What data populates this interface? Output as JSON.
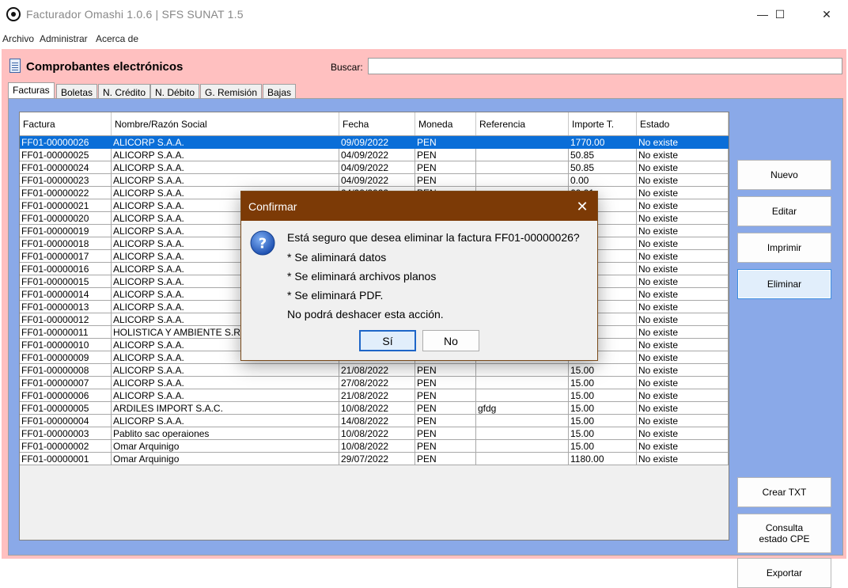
{
  "window": {
    "title": "Facturador Omashi 1.0.6 | SFS SUNAT 1.5",
    "minimize": "—",
    "maximize": "☐",
    "close": "✕"
  },
  "menu": [
    "Archivo",
    "Administrar",
    "Acerca de"
  ],
  "header": {
    "title": "Comprobantes electrónicos",
    "search_label": "Buscar:",
    "search_value": ""
  },
  "tabs": [
    "Facturas",
    "Boletas",
    "N. Crédito",
    "N. Débito",
    "G. Remisión",
    "Bajas"
  ],
  "table": {
    "columns": [
      "Factura",
      "Nombre/Razón Social",
      "Fecha",
      "Moneda",
      "Referencia",
      "Importe T.",
      "Estado"
    ],
    "rows": [
      [
        "FF01-00000026",
        "ALICORP S.A.A.",
        "09/09/2022",
        "PEN",
        "",
        "1770.00",
        "No existe"
      ],
      [
        "FF01-00000025",
        "ALICORP S.A.A.",
        "04/09/2022",
        "PEN",
        "",
        "50.85",
        "No existe"
      ],
      [
        "FF01-00000024",
        "ALICORP S.A.A.",
        "04/09/2022",
        "PEN",
        "",
        "50.85",
        "No existe"
      ],
      [
        "FF01-00000023",
        "ALICORP S.A.A.",
        "04/09/2022",
        "PEN",
        "",
        "0.00",
        "No existe"
      ],
      [
        "FF01-00000022",
        "ALICORP S.A.A.",
        "04/09/2022",
        "PEN",
        "",
        "60.01",
        "No existe"
      ],
      [
        "FF01-00000021",
        "ALICORP S.A.A.",
        "",
        "",
        "",
        "",
        "No existe"
      ],
      [
        "FF01-00000020",
        "ALICORP S.A.A.",
        "",
        "",
        "",
        "",
        "No existe"
      ],
      [
        "FF01-00000019",
        "ALICORP S.A.A.",
        "",
        "",
        "",
        "",
        "No existe"
      ],
      [
        "FF01-00000018",
        "ALICORP S.A.A.",
        "",
        "",
        "",
        "",
        "No existe"
      ],
      [
        "FF01-00000017",
        "ALICORP S.A.A.",
        "",
        "",
        "",
        "",
        "No existe"
      ],
      [
        "FF01-00000016",
        "ALICORP S.A.A.",
        "",
        "",
        "",
        "",
        "No existe"
      ],
      [
        "FF01-00000015",
        "ALICORP S.A.A.",
        "",
        "",
        "",
        "",
        "No existe"
      ],
      [
        "FF01-00000014",
        "ALICORP S.A.A.",
        "",
        "",
        "",
        "",
        "No existe"
      ],
      [
        "FF01-00000013",
        "ALICORP S.A.A.",
        "",
        "",
        "",
        "",
        "No existe"
      ],
      [
        "FF01-00000012",
        "ALICORP S.A.A.",
        "",
        "",
        "",
        "",
        "No existe"
      ],
      [
        "FF01-00000011",
        "HOLISTICA Y AMBIENTE S.R.L",
        "",
        "",
        "",
        "",
        "No existe"
      ],
      [
        "FF01-00000010",
        "ALICORP S.A.A.",
        "",
        "",
        "",
        "",
        "No existe"
      ],
      [
        "FF01-00000009",
        "ALICORP S.A.A.",
        "",
        "",
        "",
        "",
        "No existe"
      ],
      [
        "FF01-00000008",
        "ALICORP S.A.A.",
        "21/08/2022",
        "PEN",
        "",
        "15.00",
        "No existe"
      ],
      [
        "FF01-00000007",
        "ALICORP S.A.A.",
        "27/08/2022",
        "PEN",
        "",
        "15.00",
        "No existe"
      ],
      [
        "FF01-00000006",
        "ALICORP S.A.A.",
        "21/08/2022",
        "PEN",
        "",
        "15.00",
        "No existe"
      ],
      [
        "FF01-00000005",
        "ARDILES IMPORT S.A.C.",
        "10/08/2022",
        "PEN",
        "gfdg",
        "15.00",
        "No existe"
      ],
      [
        "FF01-00000004",
        "ALICORP S.A.A.",
        "14/08/2022",
        "PEN",
        "",
        "15.00",
        "No existe"
      ],
      [
        "FF01-00000003",
        "Pablito sac operaiones",
        "10/08/2022",
        "PEN",
        "",
        "15.00",
        "No existe"
      ],
      [
        "FF01-00000002",
        "Omar Arquinigo",
        "10/08/2022",
        "PEN",
        "",
        "15.00",
        "No existe"
      ],
      [
        "FF01-00000001",
        "Omar Arquinigo",
        "29/07/2022",
        "PEN",
        "",
        "1180.00",
        "No existe"
      ]
    ],
    "selected_row": 0
  },
  "buttons": {
    "nuevo": "Nuevo",
    "editar": "Editar",
    "imprimir": "Imprimir",
    "eliminar": "Eliminar",
    "crear_txt": "Crear TXT",
    "consulta_1": "Consulta",
    "consulta_2": "estado CPE",
    "exportar": "Exportar"
  },
  "dialog": {
    "title": "Confirmar",
    "close": "✕",
    "icon": "question-icon",
    "lines": [
      "Está seguro que desea eliminar la factura FF01-00000026?",
      "* Se aliminará datos",
      "* Se eliminará archivos planos",
      "* Se eliminará PDF.",
      "No podrá deshacer esta acción."
    ],
    "yes": "Sí",
    "no": "No"
  },
  "colors": {
    "client_bg": "#ffc0c0",
    "panel_bg": "#8aa9e8",
    "selection": "#0a6ed8",
    "dialog_title": "#7c3a06"
  }
}
